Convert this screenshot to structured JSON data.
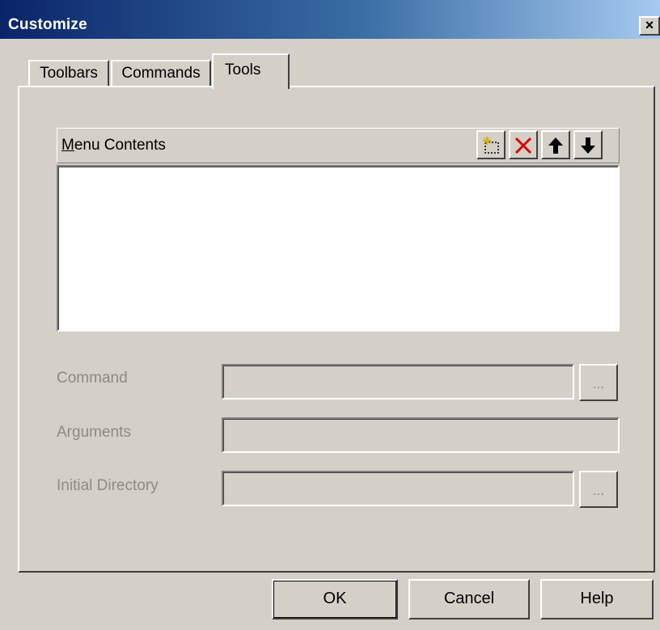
{
  "window": {
    "title": "Customize",
    "close_label": "×"
  },
  "tabs": [
    {
      "label": "Toolbars",
      "active": false
    },
    {
      "label": "Commands",
      "active": false
    },
    {
      "label": "Tools",
      "active": true
    }
  ],
  "menu_contents": {
    "label_underlined": "M",
    "label_rest": "enu Contents",
    "toolbar": [
      {
        "icon": "new-item-icon"
      },
      {
        "icon": "delete-icon"
      },
      {
        "icon": "move-up-icon"
      },
      {
        "icon": "move-down-icon"
      }
    ],
    "items": []
  },
  "fields": {
    "command": {
      "label": "Command",
      "value": "",
      "browse_label": "..."
    },
    "arguments": {
      "label": "Arguments",
      "value": ""
    },
    "initial_directory": {
      "label": "Initial Directory",
      "value": "",
      "browse_label": "..."
    }
  },
  "buttons": {
    "ok": "OK",
    "cancel": "Cancel",
    "help": "Help"
  },
  "colors": {
    "titlebar_start": "#0a246a",
    "titlebar_end": "#a6caf0",
    "face": "#d4d0c8",
    "disabled_text": "#8c8a85",
    "delete_icon": "#e00000"
  }
}
